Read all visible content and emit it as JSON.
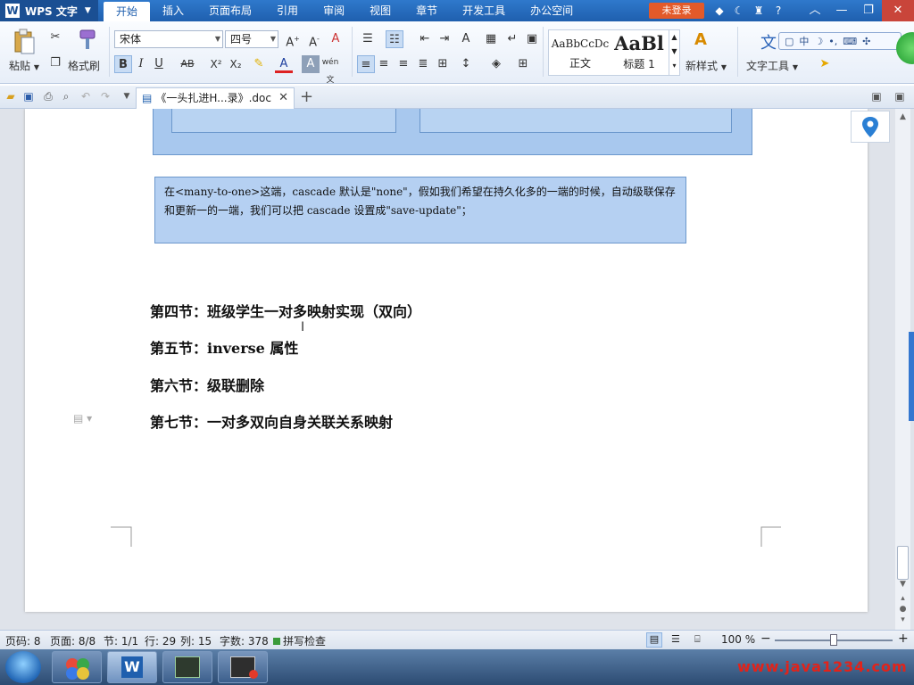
{
  "app": {
    "name": "WPS 文字",
    "logo_letter": "W"
  },
  "menu": {
    "tabs": [
      "开始",
      "插入",
      "页面布局",
      "引用",
      "审阅",
      "视图",
      "章节",
      "开发工具",
      "办公空间"
    ],
    "active": 0,
    "login_label": "未登录"
  },
  "ribbon": {
    "paste_label": "粘贴",
    "format_painter_label": "格式刷",
    "font_name": "宋体",
    "font_size": "四号",
    "styles": {
      "normal_preview": "AaBbCcDc",
      "normal_label": "正文",
      "heading_preview": "AaBl",
      "heading_label": "标题 1",
      "new_style_label": "新样式",
      "text_tools_label": "文字工具"
    },
    "ime": {
      "mode": "中"
    }
  },
  "doc_tab": {
    "title": "《一头扎进H...录》.doc"
  },
  "document": {
    "note": "在<many-to-one>这端，cascade 默认是\"none\"，假如我们希望在持久化多的一端的时候，自动级联保存和更新一的一端，我们可以把 cascade 设置成\"save-update\"；",
    "headings": [
      "第四节：班级学生一对多映射实现（双向）",
      "第五节：inverse 属性",
      "第六节：级联删除",
      "第七节：一对多双向自身关联关系映射"
    ]
  },
  "status": {
    "page_code": "页码: 8",
    "pages": "页面: 8/8",
    "section": "节: 1/1",
    "row": "行: 29",
    "col": "列: 15",
    "words": "字数: 378",
    "spell": "拼写检查",
    "zoom": "100 %",
    "zoom_fraction": 0.5
  },
  "watermark": "www.java1234.com",
  "colors": {
    "menu_bar": "#1f5fae",
    "login": "#e25a2a",
    "note_fill": "#b5d0f2",
    "accent": "#3477d0"
  }
}
